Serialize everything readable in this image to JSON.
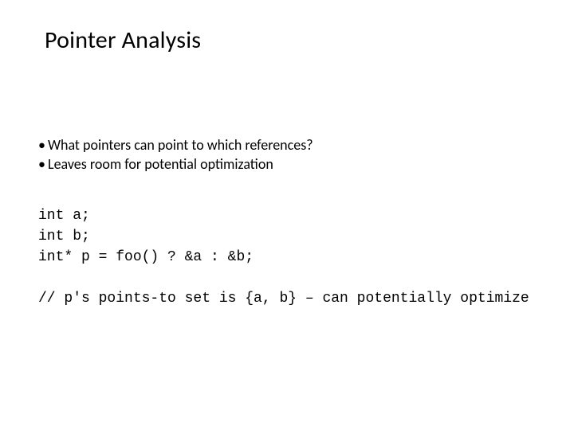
{
  "title": "Pointer Analysis",
  "bullets": [
    "What pointers can point to which references?",
    "Leaves room for potential optimization"
  ],
  "code": {
    "line1": "int a;",
    "line2": "int b;",
    "line3": "int* p = foo() ? &a : &b;",
    "comment": "// p's points-to set is {a, b} – can potentially optimize"
  }
}
